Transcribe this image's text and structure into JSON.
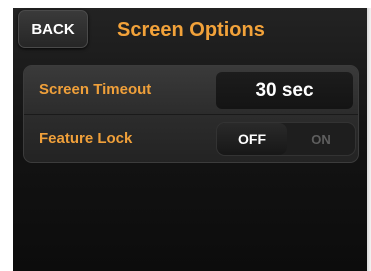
{
  "header": {
    "back_label": "BACK",
    "title": "Screen Options"
  },
  "settings": {
    "screen_timeout": {
      "label": "Screen Timeout",
      "value": "30 sec"
    },
    "feature_lock": {
      "label": "Feature Lock",
      "options": [
        "OFF",
        "ON"
      ],
      "selected": "OFF"
    }
  },
  "colors": {
    "accent": "#f0a03a",
    "background": "#141414",
    "panel": "#2c2c2c",
    "text": "#ffffff",
    "inactive_text": "#5e5e5e"
  }
}
